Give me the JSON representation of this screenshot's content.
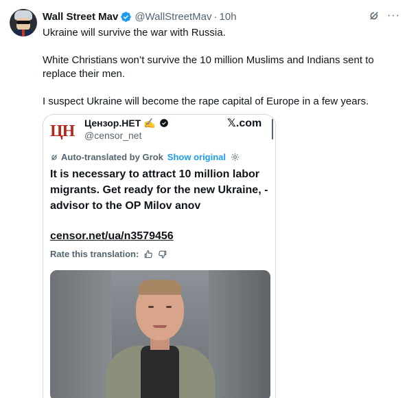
{
  "post": {
    "author_name": "Wall Street Mav",
    "author_handle": "@WallStreetMav",
    "separator": "·",
    "time": "10h",
    "paragraphs": [
      "Ukraine will survive the war with Russia.",
      "White Christians won’t survive the 10 million Muslims and Indians sent to replace their men.",
      "I suspect Ukraine will become the rape capital of Europe in a few years."
    ],
    "icons": {
      "grok": "grok-icon",
      "more": "more-icon",
      "verified": "verified-badge-icon"
    },
    "more_glyph": "···"
  },
  "quoted": {
    "logo_text": "ЦН",
    "name": "Цензор.НЕТ",
    "name_emoji": "✍️",
    "handle": "@censor_net",
    "source": "𝕏.com",
    "auto_translated": "Auto-translated by Grok",
    "show_original": "Show original",
    "headline": "It is necessary to attract 10 million labor migrants. Get ready for the new Ukraine, - advisor to the OP Milov anov",
    "link": "censor.net/ua/n3579456",
    "rate_label": "Rate this translation:"
  },
  "colors": {
    "accent": "#1d9bf0",
    "text": "#0f1419",
    "muted": "#536471",
    "border": "#cfd9de",
    "logo": "#b8261b"
  }
}
